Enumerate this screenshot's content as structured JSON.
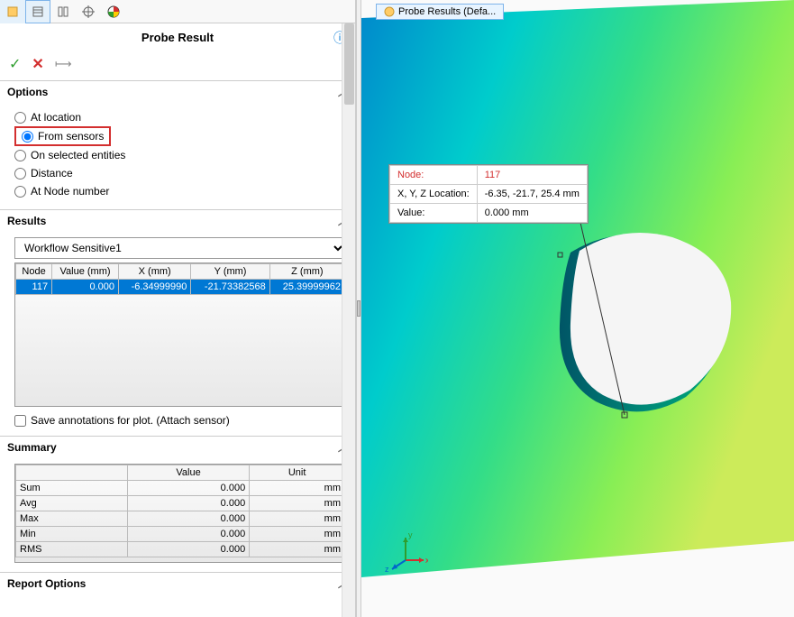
{
  "panel": {
    "title": "Probe Result",
    "tabs": [
      "tab1",
      "tab2",
      "tab3",
      "tab4",
      "tab5"
    ]
  },
  "options": {
    "header": "Options",
    "items": [
      {
        "label": "At location",
        "checked": false
      },
      {
        "label": "From sensors",
        "checked": true,
        "highlighted": true
      },
      {
        "label": "On selected entities",
        "checked": false
      },
      {
        "label": "Distance",
        "checked": false
      },
      {
        "label": "At Node number",
        "checked": false
      }
    ]
  },
  "results": {
    "header": "Results",
    "dropdown": "Workflow Sensitive1",
    "columns": [
      "Node",
      "Value (mm)",
      "X (mm)",
      "Y (mm)",
      "Z (mm)"
    ],
    "rows": [
      {
        "node": "117",
        "value": "0.000",
        "x": "-6.34999990",
        "y": "-21.73382568",
        "z": "25.39999962",
        "selected": true
      }
    ],
    "checkbox_label": "Save annotations for plot. (Attach sensor)"
  },
  "summary": {
    "header": "Summary",
    "columns": [
      "",
      "Value",
      "Unit"
    ],
    "rows": [
      {
        "label": "Sum",
        "value": "0.000",
        "unit": "mm"
      },
      {
        "label": "Avg",
        "value": "0.000",
        "unit": "mm"
      },
      {
        "label": "Max",
        "value": "0.000",
        "unit": "mm"
      },
      {
        "label": "Min",
        "value": "0.000",
        "unit": "mm"
      },
      {
        "label": "RMS",
        "value": "0.000",
        "unit": "mm"
      }
    ]
  },
  "report_options": {
    "header": "Report Options"
  },
  "viewport": {
    "tab_label": "Probe Results  (Defa...",
    "tooltip": {
      "node_label": "Node:",
      "node_value": "117",
      "loc_label": "X, Y, Z Location:",
      "loc_value": "-6.35, -21.7, 25.4 mm",
      "val_label": "Value:",
      "val_value": "0.000 mm"
    },
    "triad": {
      "x": "x",
      "y": "y",
      "z": "z"
    }
  }
}
